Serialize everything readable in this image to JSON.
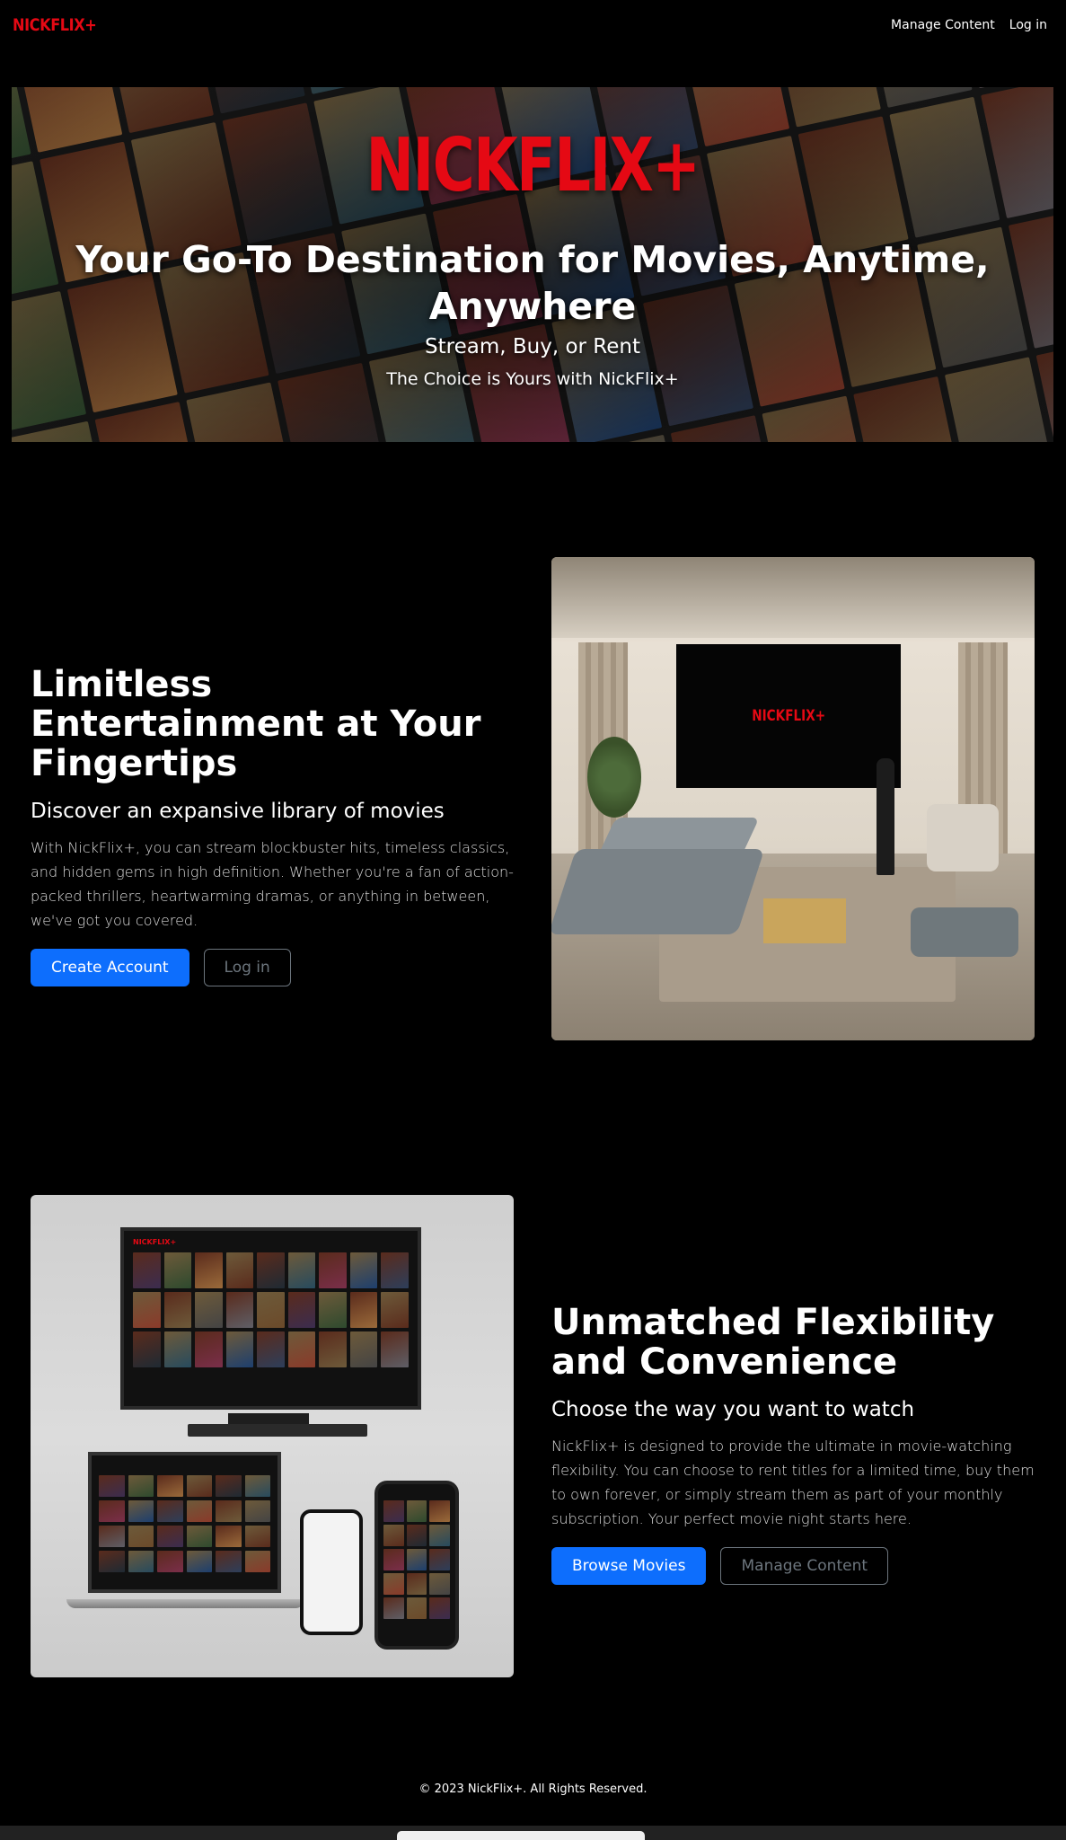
{
  "navbar": {
    "brand": "NICKFLIX+",
    "links": [
      "Manage Content",
      "Log in"
    ]
  },
  "hero": {
    "logo": "NICKFLIX+",
    "title": "Your Go-To Destination for Movies, Anytime, Anywhere",
    "subtitle": "Stream, Buy, or Rent",
    "tagline": "The Choice is Yours with NickFlix+"
  },
  "section1": {
    "heading": "Limitless Entertainment at Your Fingertips",
    "subheading": "Discover an expansive library of movies",
    "body": "With NickFlix+, you can stream blockbuster hits, timeless classics, and hidden gems in high definition. Whether you're a fan of action-packed thrillers, heartwarming dramas, or anything in between, we've got you covered.",
    "primary_button": "Create Account",
    "secondary_button": "Log in",
    "image_tv_logo": "NICKFLIX+"
  },
  "section2": {
    "heading": "Unmatched Flexibility and Convenience",
    "subheading": "Choose the way you want to watch",
    "body": "NickFlix+ is designed to provide the ultimate in movie-watching flexibility. You can choose to rent titles for a limited time, buy them to own forever, or simply stream them as part of your monthly subscription. Your perfect movie night starts here.",
    "primary_button": "Browse Movies",
    "secondary_button": "Manage Content"
  },
  "footer": {
    "text": "© 2023 NickFlix+. All Rights Reserved."
  },
  "colors": {
    "brand_red": "#e50914",
    "primary_blue": "#0d6efd",
    "outline_gray": "#6c757d",
    "background": "#000000"
  }
}
